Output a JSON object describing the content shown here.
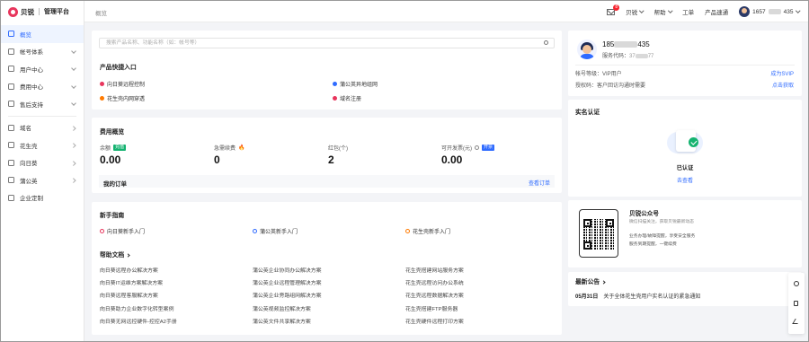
{
  "brand": {
    "name": "贝锐",
    "subtitle": "管理平台"
  },
  "sidebar": {
    "items": [
      {
        "label": "概览",
        "icon": "overview-icon",
        "active": true
      },
      {
        "label": "帐号体系",
        "icon": "account-icon",
        "arrow": "down"
      },
      {
        "label": "用户中心",
        "icon": "user-center-icon",
        "arrow": "down"
      },
      {
        "label": "费用中心",
        "icon": "billing-icon",
        "arrow": "down"
      },
      {
        "label": "售后支持",
        "icon": "support-icon",
        "arrow": "down"
      },
      {
        "label": "域名",
        "icon": "domain-icon",
        "arrow": "right",
        "divider_before": true
      },
      {
        "label": "花生壳",
        "icon": "oray-peanut-icon",
        "arrow": "right"
      },
      {
        "label": "向日葵",
        "icon": "sunflower-icon",
        "arrow": "right"
      },
      {
        "label": "蒲公英",
        "icon": "dandelion-icon",
        "arrow": "right"
      },
      {
        "label": "企业定制",
        "icon": "enterprise-icon"
      }
    ]
  },
  "topbar": {
    "breadcrumb": "概览",
    "mail_badge": "8",
    "menus": [
      "贝锐",
      "帮助",
      "工单",
      "产品速通"
    ],
    "account": {
      "prefix": "1657",
      "suffix": "435"
    }
  },
  "search": {
    "placeholder": "搜索产品名称、功能名称（如：帐号等）"
  },
  "quick": {
    "title": "产品快捷入口",
    "items": [
      "向日葵远程控制",
      "蒲公英异地组网",
      "花生壳内网穿透",
      "域名注册"
    ]
  },
  "fees": {
    "title": "费用概览",
    "items": [
      {
        "label": "余额",
        "tag": "充值",
        "value": "0.00"
      },
      {
        "label": "急需续费",
        "value": "0"
      },
      {
        "label": "红包(个)",
        "value": "2"
      },
      {
        "label": "可开发票(元)",
        "tag": "开票",
        "value": "0.00"
      }
    ],
    "orders_label": "我的订单",
    "orders_link": "查看订单"
  },
  "guide": {
    "title": "新手指南",
    "items": [
      "向日葵新手入门",
      "蒲公英新手入门",
      "花生壳新手入门"
    ]
  },
  "docs": {
    "title": "帮助文档",
    "cols": [
      [
        "向日葵远程办公解决方案",
        "向日葵IT运维方案解决方案",
        "向日葵远程客服解决方案",
        "向日葵助力企业数字化转型案例",
        "向日葵无网远控硬件-控控A2手册"
      ],
      [
        "蒲公英企业协同办公解决方案",
        "蒲公英企业远程管理解决方案",
        "蒲公英企业旁路组网解决方案",
        "蒲公英视频监控解决方案",
        "蒲公英文件共享解决方案"
      ],
      [
        "花生壳搭建网站服务方案",
        "花生壳远程访问办公系统",
        "花生壳远程数据解决方案",
        "花生壳搭建FTP服务器",
        "花生壳硬件远程打印方案"
      ]
    ]
  },
  "profile": {
    "phone_prefix": "185",
    "phone_suffix": "435",
    "service_code_label": "服务代码：",
    "service_code_prefix": "37",
    "service_code_suffix": "77",
    "level_label": "帐号等级：",
    "level_value": "VIP用户",
    "level_link": "成为SVIP",
    "auth_label": "授权码：",
    "auth_value": "客户回访沟通时需要",
    "auth_link": "点击获取"
  },
  "realname": {
    "title": "实名认证",
    "status": "已认证",
    "link": "去查看"
  },
  "wechat": {
    "title": "贝锐公众号",
    "lines": [
      "微信扫描关注，获取贝锐最新动态",
      "业务办理/故障提醒，享受安全服务",
      "服务到期提醒，一键续费"
    ]
  },
  "news": {
    "title": "最新公告",
    "date": "05月31日",
    "text": "关于全体花生壳用户实名认证的紧急通知"
  },
  "float": [
    "headset-icon",
    "document-icon",
    "edit-icon"
  ],
  "colors": {
    "accent": "#2f6bff",
    "brand": "#e8355c",
    "success": "#15b371"
  }
}
